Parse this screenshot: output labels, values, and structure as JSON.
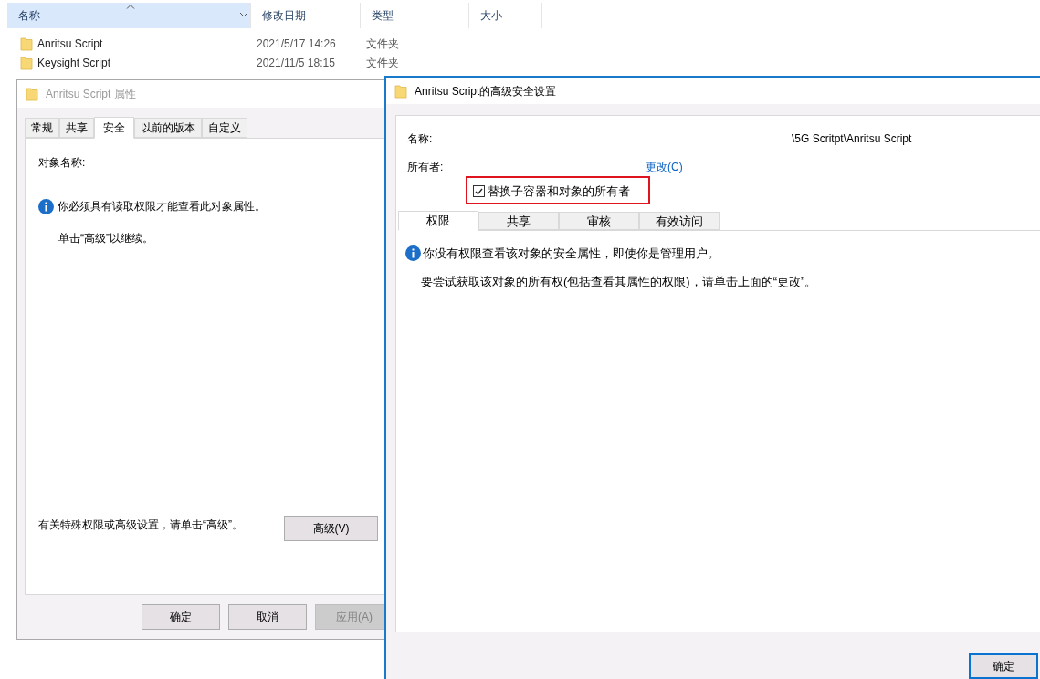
{
  "explorer": {
    "columns": [
      {
        "label": "名称",
        "selected": true
      },
      {
        "label": "修改日期",
        "selected": false
      },
      {
        "label": "类型",
        "selected": false
      },
      {
        "label": "大小",
        "selected": false
      }
    ],
    "rows": [
      {
        "name": "Anritsu Script",
        "modified": "2021/5/17 14:26",
        "type": "文件夹"
      },
      {
        "name": "Keysight Script",
        "modified": "2021/11/5 18:15",
        "type": "文件夹"
      }
    ]
  },
  "properties_dialog": {
    "title": "Anritsu Script 属性",
    "active": false,
    "tabs": [
      {
        "label": "常规",
        "selected": false
      },
      {
        "label": "共享",
        "selected": false
      },
      {
        "label": "安全",
        "selected": true
      },
      {
        "label": "以前的版本",
        "selected": false
      },
      {
        "label": "自定义",
        "selected": false
      }
    ],
    "object_name_label": "对象名称:",
    "info": "你必须具有读取权限才能查看此对象属性。",
    "hint": "单击“高级”以继续。",
    "advanced_text": "有关特殊权限或高级设置，请单击“高级”。",
    "advanced_button": "高级(V)",
    "buttons": [
      {
        "label": "确定",
        "disabled": false
      },
      {
        "label": "取消",
        "disabled": false
      },
      {
        "label": "应用(A)",
        "disabled": true
      }
    ]
  },
  "advanced_dialog": {
    "title": "Anritsu Script的高级安全设置",
    "active": true,
    "name_label": "名称:",
    "name_value": "\\5G Scritpt\\Anritsu Script",
    "owner_label": "所有者:",
    "change_link": "更改(C)",
    "replace_owner": {
      "label": "替换子容器和对象的所有者",
      "checked": true
    },
    "tabs": [
      {
        "label": "权限",
        "selected": true
      },
      {
        "label": "共享",
        "selected": false
      },
      {
        "label": "审核",
        "selected": false
      },
      {
        "label": "有效访问",
        "selected": false
      }
    ],
    "info": "你没有权限查看该对象的安全属性，即使你是管理用户。",
    "hint": "要尝试获取该对象的所有权(包括查看其属性的权限)，请单击上面的“更改”。",
    "buttons": [
      {
        "label": "确定",
        "disabled": false
      }
    ]
  }
}
